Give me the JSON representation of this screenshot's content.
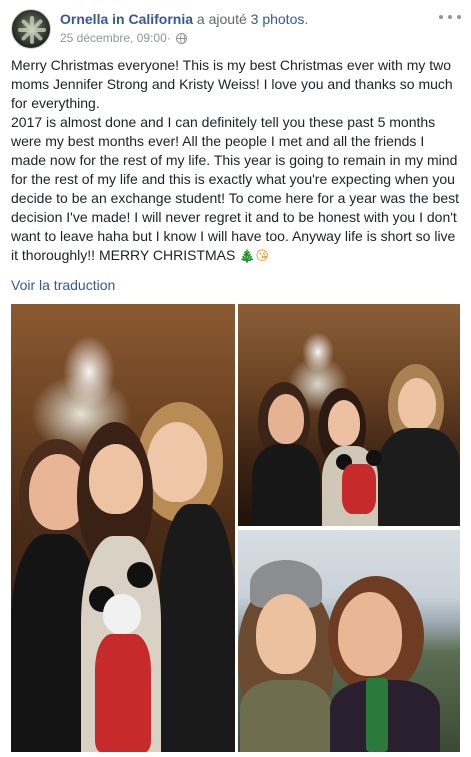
{
  "post": {
    "author": "Ornella in California",
    "action": " a ajouté ",
    "photos_link": "3 photos",
    "period": ".",
    "date": "25 décembre, 09:00",
    "separator": " · ",
    "paragraph1": "Merry Christmas everyone! This is my best Christmas ever with my two moms Jennifer Strong and Kristy Weiss! I love you and thanks so much for everything.",
    "paragraph2": "2017 is almost done and I can definitely tell you these past 5 months were my best months ever! All the people I met and all the friends I made now for the rest of my life. This year is going to remain in my mind for the rest of my life and this is exactly what you're expecting when you decide to be an exchange student! To come here for a year was the best decision I've made! I will never regret it and to be honest with you I don't want to leave haha but I know I will have too. Anyway life is short so live it thoroughly!! MERRY CHRISTMAS ",
    "emoji_tree": "🎄",
    "emoji_kiss": "😘",
    "translate_label": "Voir la traduction"
  },
  "icons": {
    "more": "more-options-icon",
    "privacy": "globe-icon",
    "tree": "christmas-tree-icon",
    "kiss": "kiss-face-icon"
  },
  "colors": {
    "link": "#365899",
    "meta": "#90949c",
    "text": "#1d2129"
  }
}
